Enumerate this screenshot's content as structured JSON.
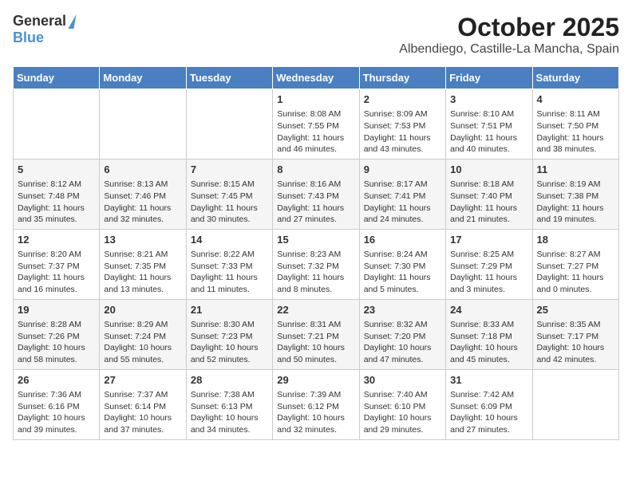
{
  "header": {
    "logo_general": "General",
    "logo_blue": "Blue",
    "title": "October 2025",
    "subtitle": "Albendiego, Castille-La Mancha, Spain"
  },
  "weekdays": [
    "Sunday",
    "Monday",
    "Tuesday",
    "Wednesday",
    "Thursday",
    "Friday",
    "Saturday"
  ],
  "weeks": [
    [
      {
        "day": "",
        "info": ""
      },
      {
        "day": "",
        "info": ""
      },
      {
        "day": "",
        "info": ""
      },
      {
        "day": "1",
        "info": "Sunrise: 8:08 AM\nSunset: 7:55 PM\nDaylight: 11 hours and 46 minutes."
      },
      {
        "day": "2",
        "info": "Sunrise: 8:09 AM\nSunset: 7:53 PM\nDaylight: 11 hours and 43 minutes."
      },
      {
        "day": "3",
        "info": "Sunrise: 8:10 AM\nSunset: 7:51 PM\nDaylight: 11 hours and 40 minutes."
      },
      {
        "day": "4",
        "info": "Sunrise: 8:11 AM\nSunset: 7:50 PM\nDaylight: 11 hours and 38 minutes."
      }
    ],
    [
      {
        "day": "5",
        "info": "Sunrise: 8:12 AM\nSunset: 7:48 PM\nDaylight: 11 hours and 35 minutes."
      },
      {
        "day": "6",
        "info": "Sunrise: 8:13 AM\nSunset: 7:46 PM\nDaylight: 11 hours and 32 minutes."
      },
      {
        "day": "7",
        "info": "Sunrise: 8:15 AM\nSunset: 7:45 PM\nDaylight: 11 hours and 30 minutes."
      },
      {
        "day": "8",
        "info": "Sunrise: 8:16 AM\nSunset: 7:43 PM\nDaylight: 11 hours and 27 minutes."
      },
      {
        "day": "9",
        "info": "Sunrise: 8:17 AM\nSunset: 7:41 PM\nDaylight: 11 hours and 24 minutes."
      },
      {
        "day": "10",
        "info": "Sunrise: 8:18 AM\nSunset: 7:40 PM\nDaylight: 11 hours and 21 minutes."
      },
      {
        "day": "11",
        "info": "Sunrise: 8:19 AM\nSunset: 7:38 PM\nDaylight: 11 hours and 19 minutes."
      }
    ],
    [
      {
        "day": "12",
        "info": "Sunrise: 8:20 AM\nSunset: 7:37 PM\nDaylight: 11 hours and 16 minutes."
      },
      {
        "day": "13",
        "info": "Sunrise: 8:21 AM\nSunset: 7:35 PM\nDaylight: 11 hours and 13 minutes."
      },
      {
        "day": "14",
        "info": "Sunrise: 8:22 AM\nSunset: 7:33 PM\nDaylight: 11 hours and 11 minutes."
      },
      {
        "day": "15",
        "info": "Sunrise: 8:23 AM\nSunset: 7:32 PM\nDaylight: 11 hours and 8 minutes."
      },
      {
        "day": "16",
        "info": "Sunrise: 8:24 AM\nSunset: 7:30 PM\nDaylight: 11 hours and 5 minutes."
      },
      {
        "day": "17",
        "info": "Sunrise: 8:25 AM\nSunset: 7:29 PM\nDaylight: 11 hours and 3 minutes."
      },
      {
        "day": "18",
        "info": "Sunrise: 8:27 AM\nSunset: 7:27 PM\nDaylight: 11 hours and 0 minutes."
      }
    ],
    [
      {
        "day": "19",
        "info": "Sunrise: 8:28 AM\nSunset: 7:26 PM\nDaylight: 10 hours and 58 minutes."
      },
      {
        "day": "20",
        "info": "Sunrise: 8:29 AM\nSunset: 7:24 PM\nDaylight: 10 hours and 55 minutes."
      },
      {
        "day": "21",
        "info": "Sunrise: 8:30 AM\nSunset: 7:23 PM\nDaylight: 10 hours and 52 minutes."
      },
      {
        "day": "22",
        "info": "Sunrise: 8:31 AM\nSunset: 7:21 PM\nDaylight: 10 hours and 50 minutes."
      },
      {
        "day": "23",
        "info": "Sunrise: 8:32 AM\nSunset: 7:20 PM\nDaylight: 10 hours and 47 minutes."
      },
      {
        "day": "24",
        "info": "Sunrise: 8:33 AM\nSunset: 7:18 PM\nDaylight: 10 hours and 45 minutes."
      },
      {
        "day": "25",
        "info": "Sunrise: 8:35 AM\nSunset: 7:17 PM\nDaylight: 10 hours and 42 minutes."
      }
    ],
    [
      {
        "day": "26",
        "info": "Sunrise: 7:36 AM\nSunset: 6:16 PM\nDaylight: 10 hours and 39 minutes."
      },
      {
        "day": "27",
        "info": "Sunrise: 7:37 AM\nSunset: 6:14 PM\nDaylight: 10 hours and 37 minutes."
      },
      {
        "day": "28",
        "info": "Sunrise: 7:38 AM\nSunset: 6:13 PM\nDaylight: 10 hours and 34 minutes."
      },
      {
        "day": "29",
        "info": "Sunrise: 7:39 AM\nSunset: 6:12 PM\nDaylight: 10 hours and 32 minutes."
      },
      {
        "day": "30",
        "info": "Sunrise: 7:40 AM\nSunset: 6:10 PM\nDaylight: 10 hours and 29 minutes."
      },
      {
        "day": "31",
        "info": "Sunrise: 7:42 AM\nSunset: 6:09 PM\nDaylight: 10 hours and 27 minutes."
      },
      {
        "day": "",
        "info": ""
      }
    ]
  ]
}
